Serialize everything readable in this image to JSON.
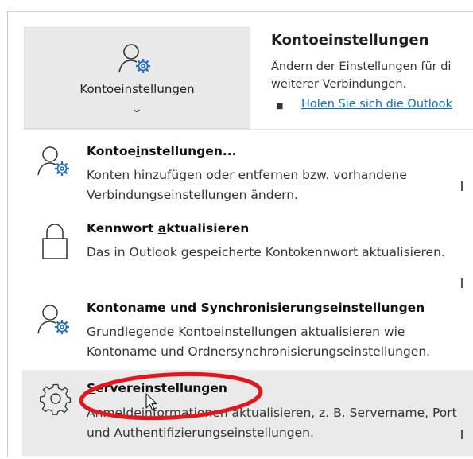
{
  "ribbon": {
    "button_label": "Kontoeinstellungen",
    "chevron": "⌄",
    "info_title": "Kontoeinstellungen",
    "info_desc": "Ändern der Einstellungen für di weiterer Verbindungen.",
    "bullet": "■",
    "info_link": "Holen Sie sich die Outlook"
  },
  "menu": {
    "items": [
      {
        "title_pre": "Kontoe",
        "title_key": "i",
        "title_post": "nstellungen...",
        "desc": "Konten hinzufügen oder entfernen bzw. vorhandene Verbindungseinstellungen ändern.",
        "icon": "account-settings-icon"
      },
      {
        "title_pre": "Kennwort ",
        "title_key": "a",
        "title_post": "ktualisieren",
        "desc": "Das in Outlook gespeicherte Kontokennwort aktualisieren.",
        "icon": "lock-icon"
      },
      {
        "title_pre": "Konto",
        "title_key": "n",
        "title_post": "ame und Synchronisierungseinstellungen",
        "desc": "Grundlegende Kontoeinstellungen aktualisieren wie Kontoname und Ordnersynchronisierungseinstellungen.",
        "icon": "account-settings-icon"
      },
      {
        "title_pre": "",
        "title_key": "S",
        "title_post": "ervereinstellungen",
        "desc": "Anmeldeinformationen aktualisieren, z. B. Servername, Port und Authentifizierungseinstellungen.",
        "icon": "gear-icon",
        "highlighted": true
      }
    ]
  },
  "colors": {
    "annotation": "#e3161b",
    "link": "#0f6cbd",
    "icon_blue": "#1e6fc7"
  }
}
